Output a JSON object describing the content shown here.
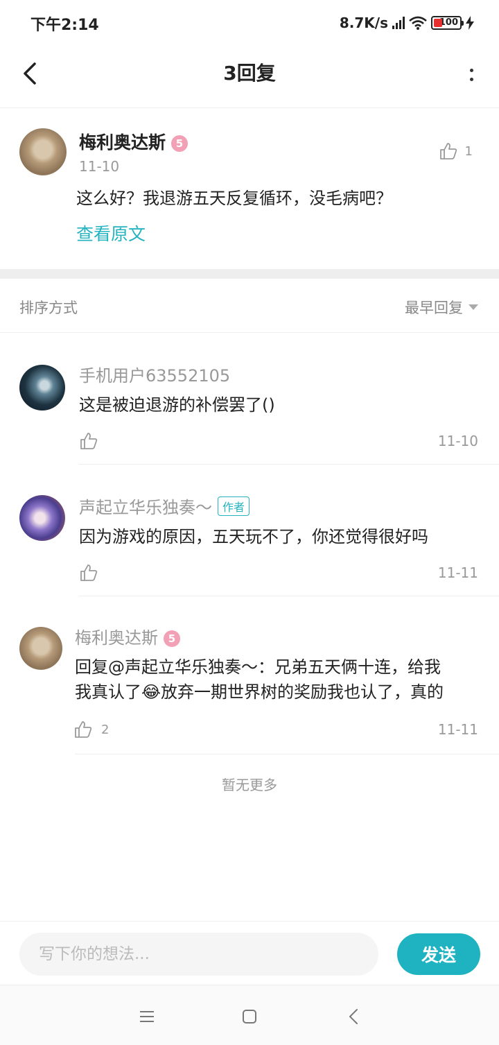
{
  "status_bar": {
    "time": "下午2:14",
    "net_speed": "8.7K/s",
    "battery": "100"
  },
  "header": {
    "title": "3回复"
  },
  "main_comment": {
    "author": "梅利奥达斯",
    "level_badge": "5",
    "date": "11-10",
    "text": "这么好？我退游五天反复循环，没毛病吧？",
    "likes": "1",
    "view_original": "查看原文"
  },
  "sort": {
    "label": "排序方式",
    "selected": "最早回复"
  },
  "replies": [
    {
      "name": "手机用户63552105",
      "text": "这是被迫退游的补偿罢了()",
      "date": "11-10",
      "likes": ""
    },
    {
      "name": "声起立华乐独奏～",
      "tag": "作者",
      "text": "因为游戏的原因，五天玩不了，你还觉得很好吗",
      "date": "11-11",
      "likes": ""
    },
    {
      "name": "梅利奥达斯",
      "level_badge": "5",
      "text_line1": "回复@声起立华乐独奏～：兄弟五天俩十连，给我",
      "text_line2": "我真认了😂放弃一期世界树的奖励我也认了，真的",
      "date": "11-11",
      "likes": "2"
    }
  ],
  "footer": {
    "no_more": "暂无更多",
    "input_placeholder": "写下你的想法...",
    "send_label": "发送"
  },
  "colors": {
    "accent": "#24b3c0",
    "send_button": "#1fb3c2",
    "badge_pink": "#f2a0b6"
  }
}
